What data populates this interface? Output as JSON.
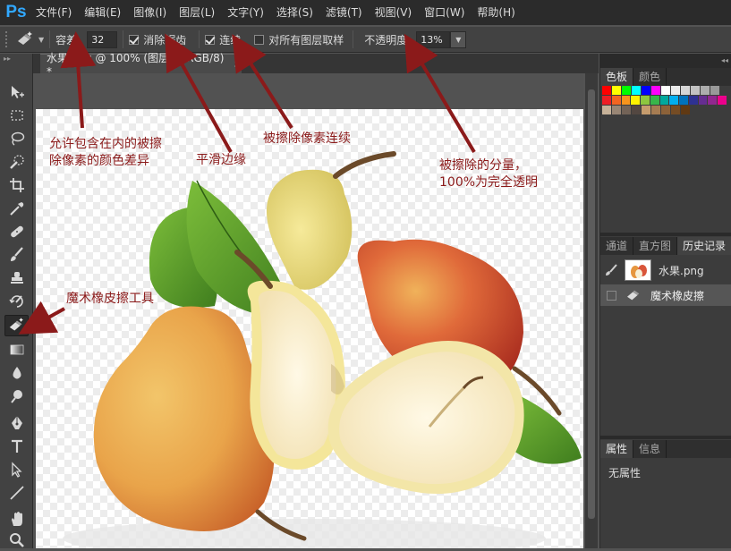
{
  "app": {
    "logo": "Ps"
  },
  "menu": [
    "文件(F)",
    "编辑(E)",
    "图像(I)",
    "图层(L)",
    "文字(Y)",
    "选择(S)",
    "滤镜(T)",
    "视图(V)",
    "窗口(W)",
    "帮助(H)"
  ],
  "options": {
    "tolerance_label": "容差:",
    "tolerance_value": "32",
    "antialias_label": "消除锯齿",
    "antialias_checked": true,
    "contiguous_label": "连续",
    "contiguous_checked": true,
    "sample_all_label": "对所有图层取样",
    "sample_all_checked": false,
    "opacity_label": "不透明度:",
    "opacity_value": "13%"
  },
  "document": {
    "tab_title": "水果.png @ 100% (图层 0, RGB/8) *",
    "close_glyph": "×"
  },
  "panels": {
    "swatches_tabs": [
      "色板",
      "颜色"
    ],
    "history_tabs": [
      "通道",
      "直方图",
      "历史记录"
    ],
    "history_items": [
      {
        "label": "水果.png",
        "icon": "snapshot-icon"
      },
      {
        "label": "魔术橡皮擦",
        "icon": "magic-eraser-icon"
      }
    ],
    "properties_tabs": [
      "属性",
      "信息"
    ],
    "properties_text": "无属性"
  },
  "swatch_colors": [
    [
      "#ff0000",
      "#ffff00",
      "#00ff00",
      "#00ffff",
      "#0000ff",
      "#ff00ff",
      "#ffffff",
      "#ebebeb",
      "#d6d6d6",
      "#c2c2c2",
      "#adadad",
      "#999999"
    ],
    [
      "#ee1d24",
      "#f26522",
      "#f7941d",
      "#fff200",
      "#8dc63f",
      "#39b54a",
      "#00a99d",
      "#00aeef",
      "#0072bc",
      "#2e3192",
      "#662d91",
      "#92278f",
      "#ec008c"
    ],
    [
      "#c7b299",
      "#998675",
      "#736357",
      "#534741",
      "#c69c6d",
      "#a67c52",
      "#8c6239",
      "#754c24",
      "#603913"
    ]
  ],
  "annotations": {
    "tolerance": "允许包含在内的被擦\n除像素的颜色差异",
    "antialias": "平滑边缘",
    "contiguous": "被擦除像素连续",
    "opacity": "被擦除的分量，\n100%为完全透明",
    "tool": "魔术橡皮擦工具"
  },
  "colors": {
    "annotation": "#8b1a1a",
    "logo": "#31a8ff"
  }
}
